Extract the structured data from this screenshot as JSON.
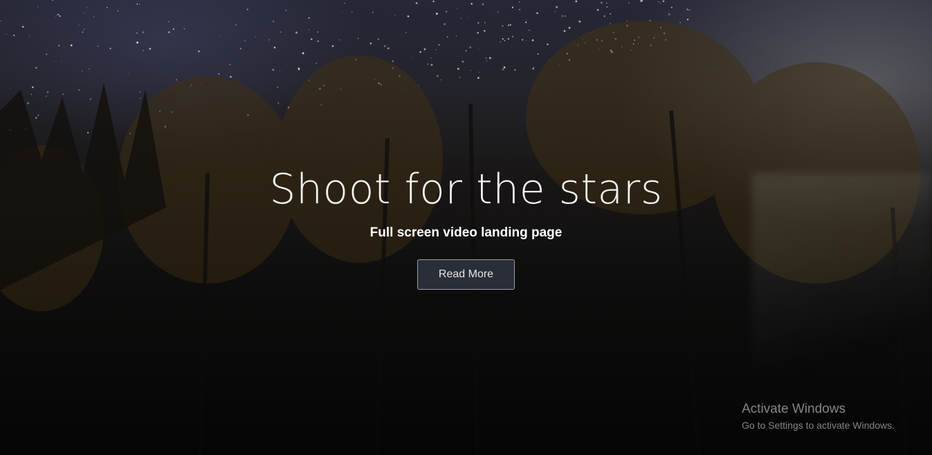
{
  "hero": {
    "title": "Shoot for the stars",
    "subtitle": "Full screen video landing page",
    "button_label": "Read More"
  },
  "watermark": {
    "title": "Activate Windows",
    "subtitle": "Go to Settings to activate Windows."
  },
  "colors": {
    "sky_top": "#2a2c3c",
    "ground": "#0b0b0c",
    "button_bg": "#2a2e38",
    "button_border": "#9a9ea6",
    "foliage": "#6b4f1e"
  }
}
